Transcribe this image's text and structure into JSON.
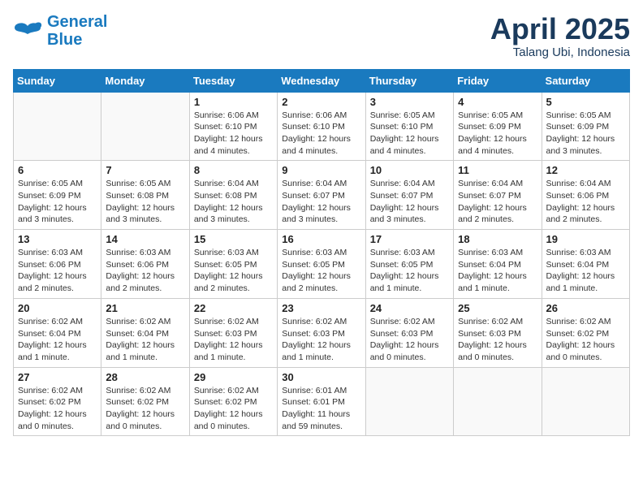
{
  "header": {
    "logo_line1": "General",
    "logo_line2": "Blue",
    "month": "April 2025",
    "location": "Talang Ubi, Indonesia"
  },
  "weekdays": [
    "Sunday",
    "Monday",
    "Tuesday",
    "Wednesday",
    "Thursday",
    "Friday",
    "Saturday"
  ],
  "weeks": [
    [
      {
        "day": "",
        "info": ""
      },
      {
        "day": "",
        "info": ""
      },
      {
        "day": "1",
        "info": "Sunrise: 6:06 AM\nSunset: 6:10 PM\nDaylight: 12 hours\nand 4 minutes."
      },
      {
        "day": "2",
        "info": "Sunrise: 6:06 AM\nSunset: 6:10 PM\nDaylight: 12 hours\nand 4 minutes."
      },
      {
        "day": "3",
        "info": "Sunrise: 6:05 AM\nSunset: 6:10 PM\nDaylight: 12 hours\nand 4 minutes."
      },
      {
        "day": "4",
        "info": "Sunrise: 6:05 AM\nSunset: 6:09 PM\nDaylight: 12 hours\nand 4 minutes."
      },
      {
        "day": "5",
        "info": "Sunrise: 6:05 AM\nSunset: 6:09 PM\nDaylight: 12 hours\nand 3 minutes."
      }
    ],
    [
      {
        "day": "6",
        "info": "Sunrise: 6:05 AM\nSunset: 6:09 PM\nDaylight: 12 hours\nand 3 minutes."
      },
      {
        "day": "7",
        "info": "Sunrise: 6:05 AM\nSunset: 6:08 PM\nDaylight: 12 hours\nand 3 minutes."
      },
      {
        "day": "8",
        "info": "Sunrise: 6:04 AM\nSunset: 6:08 PM\nDaylight: 12 hours\nand 3 minutes."
      },
      {
        "day": "9",
        "info": "Sunrise: 6:04 AM\nSunset: 6:07 PM\nDaylight: 12 hours\nand 3 minutes."
      },
      {
        "day": "10",
        "info": "Sunrise: 6:04 AM\nSunset: 6:07 PM\nDaylight: 12 hours\nand 3 minutes."
      },
      {
        "day": "11",
        "info": "Sunrise: 6:04 AM\nSunset: 6:07 PM\nDaylight: 12 hours\nand 2 minutes."
      },
      {
        "day": "12",
        "info": "Sunrise: 6:04 AM\nSunset: 6:06 PM\nDaylight: 12 hours\nand 2 minutes."
      }
    ],
    [
      {
        "day": "13",
        "info": "Sunrise: 6:03 AM\nSunset: 6:06 PM\nDaylight: 12 hours\nand 2 minutes."
      },
      {
        "day": "14",
        "info": "Sunrise: 6:03 AM\nSunset: 6:06 PM\nDaylight: 12 hours\nand 2 minutes."
      },
      {
        "day": "15",
        "info": "Sunrise: 6:03 AM\nSunset: 6:05 PM\nDaylight: 12 hours\nand 2 minutes."
      },
      {
        "day": "16",
        "info": "Sunrise: 6:03 AM\nSunset: 6:05 PM\nDaylight: 12 hours\nand 2 minutes."
      },
      {
        "day": "17",
        "info": "Sunrise: 6:03 AM\nSunset: 6:05 PM\nDaylight: 12 hours\nand 1 minute."
      },
      {
        "day": "18",
        "info": "Sunrise: 6:03 AM\nSunset: 6:04 PM\nDaylight: 12 hours\nand 1 minute."
      },
      {
        "day": "19",
        "info": "Sunrise: 6:03 AM\nSunset: 6:04 PM\nDaylight: 12 hours\nand 1 minute."
      }
    ],
    [
      {
        "day": "20",
        "info": "Sunrise: 6:02 AM\nSunset: 6:04 PM\nDaylight: 12 hours\nand 1 minute."
      },
      {
        "day": "21",
        "info": "Sunrise: 6:02 AM\nSunset: 6:04 PM\nDaylight: 12 hours\nand 1 minute."
      },
      {
        "day": "22",
        "info": "Sunrise: 6:02 AM\nSunset: 6:03 PM\nDaylight: 12 hours\nand 1 minute."
      },
      {
        "day": "23",
        "info": "Sunrise: 6:02 AM\nSunset: 6:03 PM\nDaylight: 12 hours\nand 1 minute."
      },
      {
        "day": "24",
        "info": "Sunrise: 6:02 AM\nSunset: 6:03 PM\nDaylight: 12 hours\nand 0 minutes."
      },
      {
        "day": "25",
        "info": "Sunrise: 6:02 AM\nSunset: 6:03 PM\nDaylight: 12 hours\nand 0 minutes."
      },
      {
        "day": "26",
        "info": "Sunrise: 6:02 AM\nSunset: 6:02 PM\nDaylight: 12 hours\nand 0 minutes."
      }
    ],
    [
      {
        "day": "27",
        "info": "Sunrise: 6:02 AM\nSunset: 6:02 PM\nDaylight: 12 hours\nand 0 minutes."
      },
      {
        "day": "28",
        "info": "Sunrise: 6:02 AM\nSunset: 6:02 PM\nDaylight: 12 hours\nand 0 minutes."
      },
      {
        "day": "29",
        "info": "Sunrise: 6:02 AM\nSunset: 6:02 PM\nDaylight: 12 hours\nand 0 minutes."
      },
      {
        "day": "30",
        "info": "Sunrise: 6:01 AM\nSunset: 6:01 PM\nDaylight: 11 hours\nand 59 minutes."
      },
      {
        "day": "",
        "info": ""
      },
      {
        "day": "",
        "info": ""
      },
      {
        "day": "",
        "info": ""
      }
    ]
  ]
}
